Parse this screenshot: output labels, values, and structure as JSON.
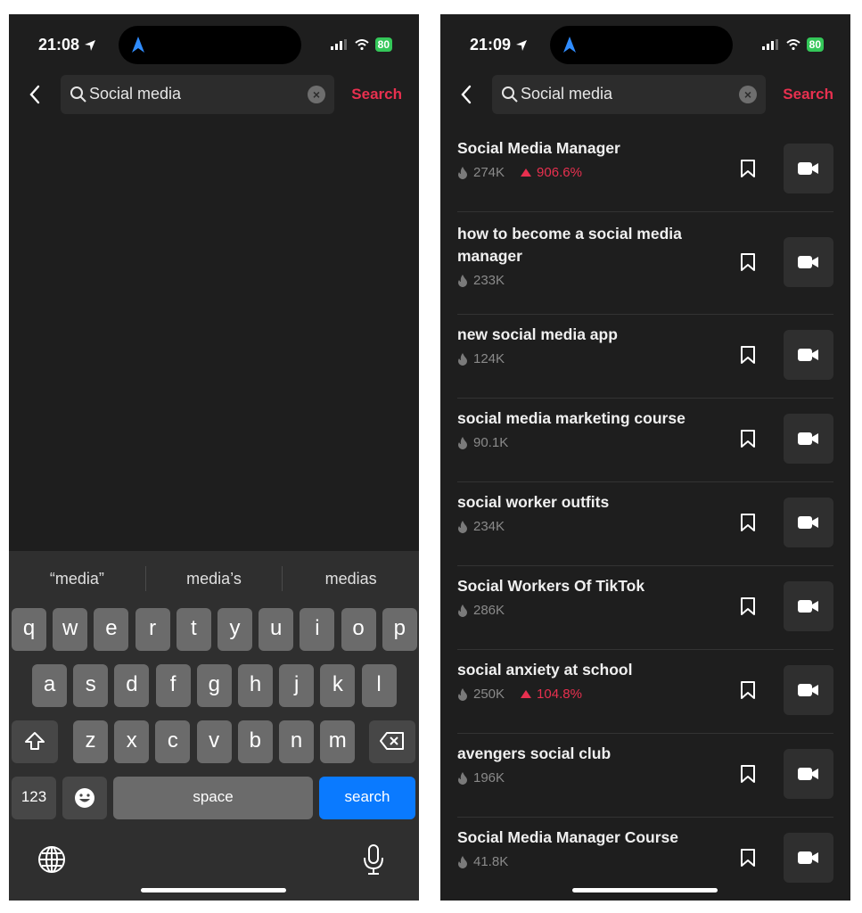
{
  "left_screen": {
    "status": {
      "time": "21:08",
      "battery": "80"
    },
    "search": {
      "query": "Social media",
      "submit_label": "Search"
    },
    "keyboard": {
      "suggestions": [
        "“media”",
        "media’s",
        "medias"
      ],
      "row1": [
        "q",
        "w",
        "e",
        "r",
        "t",
        "y",
        "u",
        "i",
        "o",
        "p"
      ],
      "row2": [
        "a",
        "s",
        "d",
        "f",
        "g",
        "h",
        "j",
        "k",
        "l"
      ],
      "row3": [
        "z",
        "x",
        "c",
        "v",
        "b",
        "n",
        "m"
      ],
      "numbers_label": "123",
      "space_label": "space",
      "search_label": "search"
    }
  },
  "right_screen": {
    "status": {
      "time": "21:09",
      "battery": "80"
    },
    "search": {
      "query": "Social media",
      "submit_label": "Search"
    },
    "results": [
      {
        "title": "Social Media Manager",
        "views": "274K",
        "trend": "906.6%"
      },
      {
        "title": "how to become a social media manager",
        "views": "233K",
        "trend": null
      },
      {
        "title": "new social media app",
        "views": "124K",
        "trend": null
      },
      {
        "title": "social media marketing course",
        "views": "90.1K",
        "trend": null
      },
      {
        "title": "social worker outfits",
        "views": "234K",
        "trend": null
      },
      {
        "title": "Social Workers Of TikTok",
        "views": "286K",
        "trend": null
      },
      {
        "title": "social anxiety at school",
        "views": "250K",
        "trend": "104.8%"
      },
      {
        "title": "avengers social club",
        "views": "196K",
        "trend": null
      },
      {
        "title": "Social Media Manager Course",
        "views": "41.8K",
        "trend": null
      }
    ]
  },
  "colors": {
    "accent": "#e8304f",
    "keyboard_action": "#0a7aff",
    "background": "#1e1e1e"
  }
}
